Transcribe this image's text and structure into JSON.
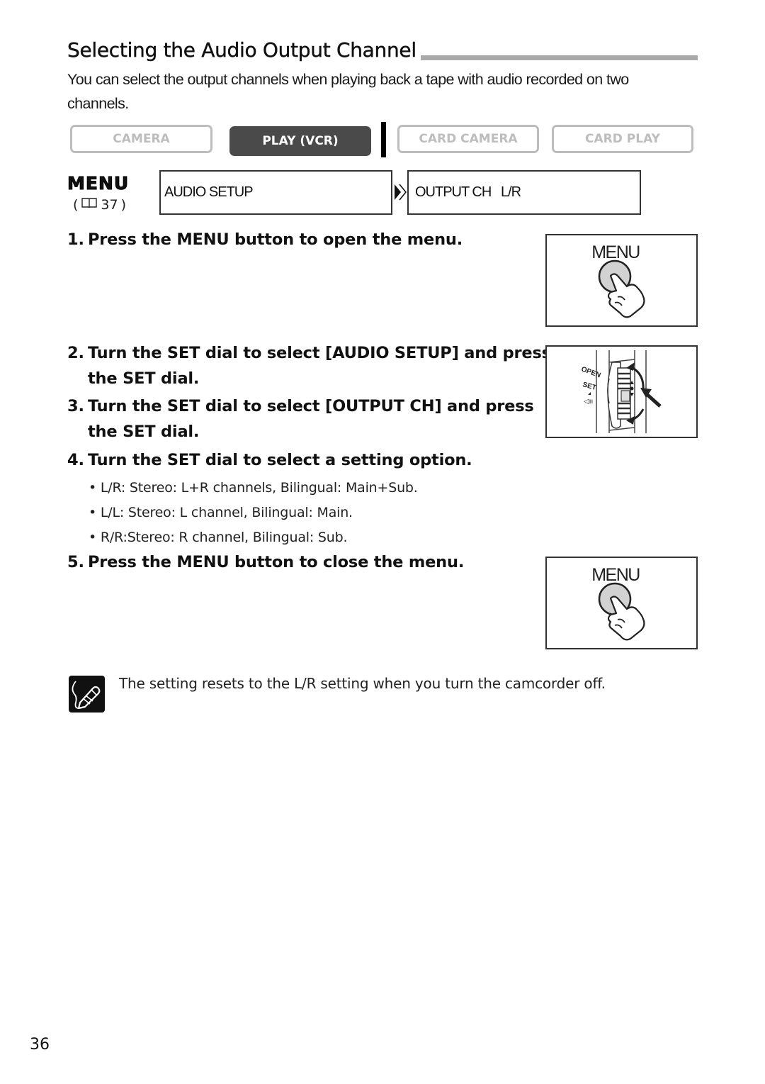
{
  "title": "Selecting the Audio Output Channel",
  "intro": "You can select the output channels when playing back a tape with audio recorded on two channels.",
  "modes": [
    {
      "label": "CAMERA",
      "active": false
    },
    {
      "label": "PLAY (VCR)",
      "active": true
    },
    {
      "label": "CARD CAMERA",
      "active": false
    },
    {
      "label": "CARD PLAY",
      "active": false
    }
  ],
  "menu": {
    "label": "MENU",
    "ref_icon": "book-icon",
    "ref_page": "37",
    "path": [
      {
        "label": "AUDIO SETUP"
      },
      {
        "label": "OUTPUT CH   L/R"
      }
    ],
    "arrow_icon": "double-chevron-right-icon"
  },
  "steps": [
    {
      "num": "1.",
      "line1": "Press the MENU button to open the menu.",
      "line2": ""
    },
    {
      "num": "2.",
      "line1": "Turn the SET dial to select [AUDIO SETUP] and press",
      "line2": "the SET dial."
    },
    {
      "num": "3.",
      "line1": "Turn the SET dial to select [OUTPUT CH] and press",
      "line2": "the SET dial."
    },
    {
      "num": "4.",
      "line1": "Turn the SET dial to select a setting option.",
      "line2": ""
    },
    {
      "num": "5.",
      "line1": "Press the MENU button to close the menu.",
      "line2": ""
    }
  ],
  "options": [
    {
      "key": "L/R:",
      "text": "Stereo: L+R channels, Bilingual: Main+Sub."
    },
    {
      "key": "L/L:",
      "text": "Stereo: L channel, Bilingual: Main."
    },
    {
      "key": "R/R:",
      "text": "Stereo: R channel, Bilingual: Sub."
    }
  ],
  "illustrations": {
    "menu_button_label": "MENU",
    "dial_labels": [
      "OPEN",
      "SET"
    ]
  },
  "note": {
    "icon": "pencil-note-icon",
    "text": "The setting resets to the L/R setting when you turn the camcorder off."
  },
  "page_number": "36"
}
